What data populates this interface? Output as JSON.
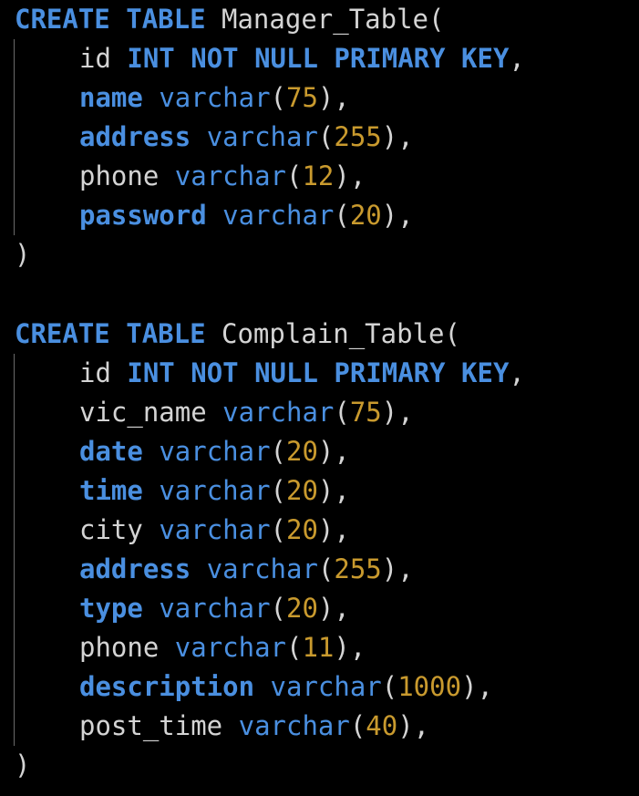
{
  "blocks": [
    {
      "header": {
        "kw1": "CREATE",
        "kw2": "TABLE",
        "name": "Manager_Table",
        "open": "("
      },
      "columns": [
        {
          "name": "id",
          "name_is_kw": false,
          "type": "INT NOT NULL PRIMARY KEY",
          "size": "",
          "sep": ","
        },
        {
          "name": "name",
          "name_is_kw": true,
          "type": "varchar",
          "size": "75",
          "sep": "),"
        },
        {
          "name": "address",
          "name_is_kw": true,
          "type": "varchar",
          "size": "255",
          "sep": "),"
        },
        {
          "name": "phone",
          "name_is_kw": false,
          "type": "varchar",
          "size": "12",
          "sep": "),"
        },
        {
          "name": "password",
          "name_is_kw": true,
          "type": "varchar",
          "size": "20",
          "sep": "),"
        }
      ],
      "close": ")"
    },
    {
      "header": {
        "kw1": "CREATE",
        "kw2": "TABLE",
        "name": "Complain_Table",
        "open": "("
      },
      "columns": [
        {
          "name": "id",
          "name_is_kw": false,
          "type": "INT NOT NULL PRIMARY KEY",
          "size": "",
          "sep": ","
        },
        {
          "name": "vic_name",
          "name_is_kw": false,
          "type": "varchar",
          "size": "75",
          "sep": "),"
        },
        {
          "name": "date",
          "name_is_kw": true,
          "type": "varchar",
          "size": "20",
          "sep": "),"
        },
        {
          "name": "time",
          "name_is_kw": true,
          "type": "varchar",
          "size": "20",
          "sep": "),"
        },
        {
          "name": "city",
          "name_is_kw": false,
          "type": "varchar",
          "size": "20",
          "sep": "),"
        },
        {
          "name": "address",
          "name_is_kw": true,
          "type": "varchar",
          "size": "255",
          "sep": "),"
        },
        {
          "name": "type",
          "name_is_kw": true,
          "type": "varchar",
          "size": "20",
          "sep": "),"
        },
        {
          "name": "phone",
          "name_is_kw": false,
          "type": "varchar",
          "size": "11",
          "sep": "),"
        },
        {
          "name": "description",
          "name_is_kw": true,
          "type": "varchar",
          "size": "1000",
          "sep": "),"
        },
        {
          "name": "post_time",
          "name_is_kw": false,
          "type": "varchar",
          "size": "40",
          "sep": "),"
        }
      ],
      "close": ")"
    }
  ],
  "colors": {
    "keyword": "#4a8fe0",
    "number": "#c99a2e",
    "text": "#d4d4d4",
    "background": "#000000",
    "indent_guide": "#6a6a6a"
  }
}
